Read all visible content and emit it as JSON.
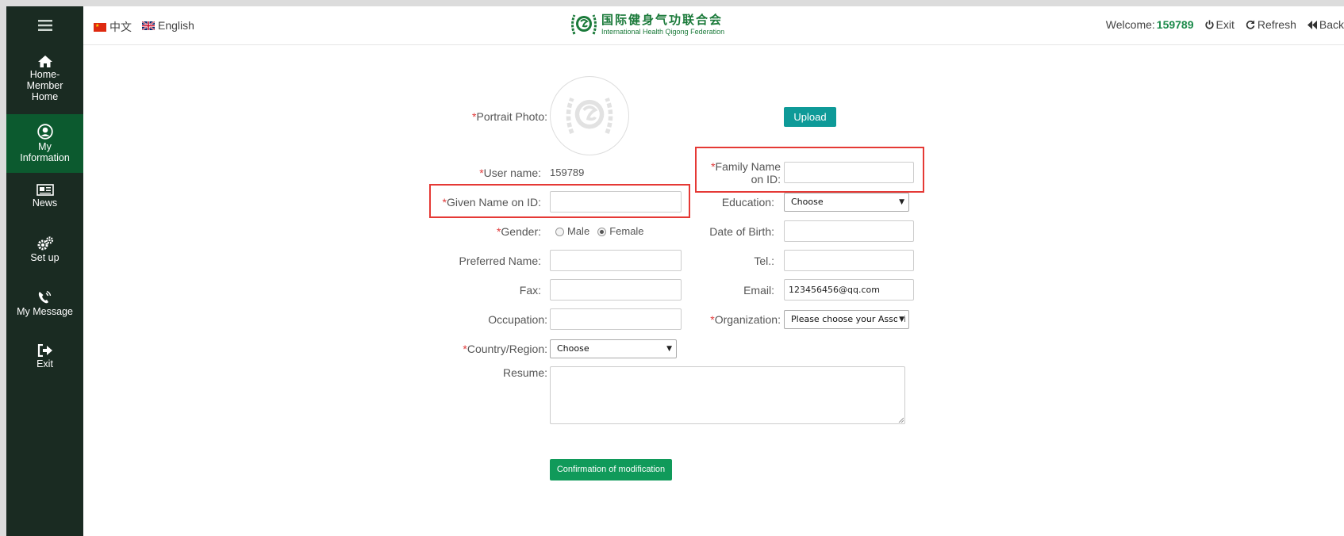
{
  "sidebar": {
    "items": [
      {
        "label": "Home-\nMember\nHome",
        "icon": "home-icon"
      },
      {
        "label": "My\nInformation",
        "icon": "user-circle-icon"
      },
      {
        "label": "News",
        "icon": "newspaper-icon"
      },
      {
        "label": "Set up",
        "icon": "gears-icon"
      },
      {
        "label": "My Message",
        "icon": "phone-volume-icon"
      },
      {
        "label": "Exit",
        "icon": "sign-out-icon"
      }
    ],
    "active_color": "#0c5a2f",
    "bg_color": "#1a2b22"
  },
  "topbar": {
    "lang_cn": "中文",
    "lang_en": "English",
    "logo_cn": "国际健身气功联合会",
    "logo_en": "International Health Qigong Federation",
    "welcome_label": "Welcome:",
    "welcome_user": "159789",
    "exit": "Exit",
    "refresh": "Refresh",
    "back": "Back"
  },
  "form": {
    "portrait_label": "Portrait Photo:",
    "upload_button": "Upload",
    "username_label": "User name:",
    "username_value": "159789",
    "family_name_label": "Family Name on ID:",
    "family_name_value": "",
    "given_name_label": "Given Name on ID:",
    "given_name_value": "",
    "education_label": "Education:",
    "education_value": "Choose",
    "gender_label": "Gender:",
    "gender_male": "Male",
    "gender_female": "Female",
    "gender_selected": "Female",
    "dob_label": "Date of Birth:",
    "dob_value": "",
    "preferred_name_label": "Preferred Name:",
    "preferred_name_value": "",
    "tel_label": "Tel.:",
    "tel_value": "",
    "fax_label": "Fax:",
    "fax_value": "",
    "email_label": "Email:",
    "email_value": "123456456@qq.com",
    "occupation_label": "Occupation:",
    "occupation_value": "",
    "organization_label": "Organization:",
    "organization_value": "Please choose your Associ",
    "country_label": "Country/Region:",
    "country_value": "Choose",
    "resume_label": "Resume:",
    "resume_value": "",
    "required_mark": "*",
    "confirm_button": "Confirmation of modification"
  },
  "colors": {
    "upload_button": "#0e9a98",
    "confirm_button": "#109a5a",
    "highlight_box": "#e53935",
    "required": "#e03a3a"
  }
}
